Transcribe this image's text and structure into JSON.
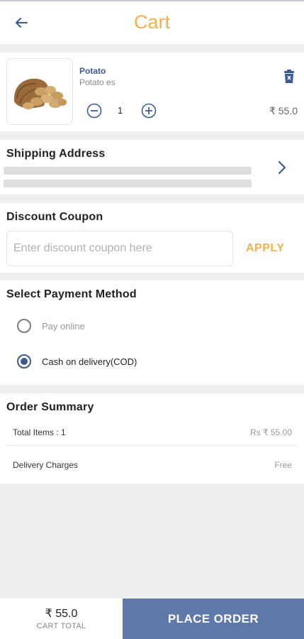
{
  "header": {
    "title": "Cart",
    "back_icon": "arrow-left-icon"
  },
  "cart_item": {
    "name": "Potato",
    "subtitle": "Potato es",
    "quantity": "1",
    "price": "₹ 55.0"
  },
  "shipping": {
    "title": "Shipping Address"
  },
  "coupon": {
    "title": "Discount Coupon",
    "placeholder": "Enter discount coupon here",
    "apply_label": "APPLY"
  },
  "payment": {
    "title": "Select Payment Method",
    "options": [
      {
        "label": "Pay online",
        "selected": false
      },
      {
        "label": "Cash on delivery(COD)",
        "selected": true
      }
    ]
  },
  "summary": {
    "title": "Order Summary",
    "rows": [
      {
        "label": "Total Items : 1",
        "value": "Rs ₹ 55.00"
      },
      {
        "label": "Delivery Charges",
        "value": "Free"
      }
    ]
  },
  "footer": {
    "cart_total_value": "₹ 55.0",
    "cart_total_label": "CART TOTAL",
    "place_order_label": "PLACE ORDER"
  },
  "colors": {
    "accent_orange": "#f1b14b",
    "brand_blue": "#5e78aa",
    "link_blue": "#3d5b93",
    "page_bg": "#efefef"
  }
}
